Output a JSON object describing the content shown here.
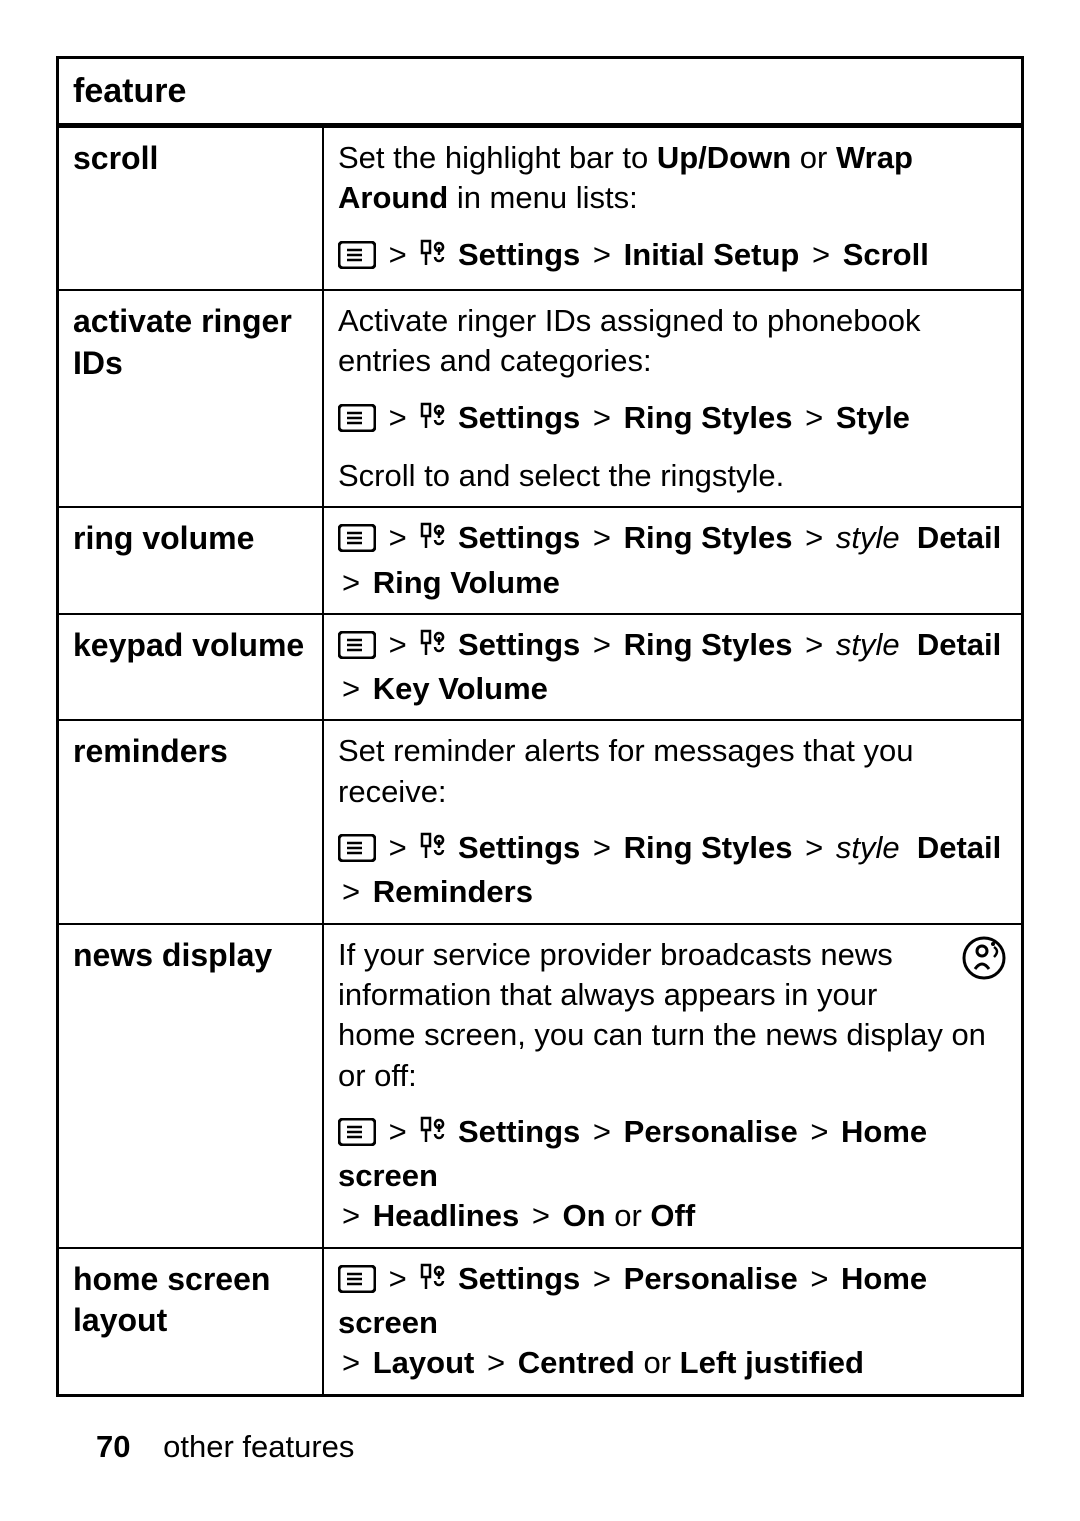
{
  "header": "feature",
  "rows": [
    {
      "feature": "scroll",
      "desc_pre": "Set the highlight bar to ",
      "desc_bold1": "Up/Down",
      "desc_mid": " or ",
      "desc_bold2": "Wrap Around",
      "desc_post": " in menu lists:",
      "nav": {
        "settings": "Settings",
        "p1": "Initial Setup",
        "p2": "Scroll"
      }
    },
    {
      "feature": "activate ringer IDs",
      "desc": "Activate ringer IDs assigned to phonebook entries and categories:",
      "nav": {
        "settings": "Settings",
        "p1": "Ring Styles",
        "p2": "Style"
      },
      "after": "Scroll to and select the ringstyle."
    },
    {
      "feature": "ring volume",
      "nav": {
        "settings": "Settings",
        "p1": "Ring Styles",
        "style_italic": "style",
        "detail": "Detail",
        "p3": "Ring Volume"
      }
    },
    {
      "feature": "keypad volume",
      "nav": {
        "settings": "Settings",
        "p1": "Ring Styles",
        "style_italic": "style",
        "detail": "Detail",
        "p3": "Key Volume"
      }
    },
    {
      "feature": "reminders",
      "desc": "Set reminder alerts for messages that you receive:",
      "nav": {
        "settings": "Settings",
        "p1": "Ring Styles",
        "style_italic": "style",
        "detail": "Detail",
        "p3": "Reminders"
      }
    },
    {
      "feature": "news display",
      "desc": "If your service provider broadcasts news information that always appears in your home screen, you can turn the news display on or off:",
      "operator_icon": true,
      "nav": {
        "settings": "Settings",
        "p1": "Personalise",
        "p2": "Home screen",
        "p3": "Headlines",
        "p4a": "On",
        "or": " or ",
        "p4b": "Off"
      }
    },
    {
      "feature": "home screen layout",
      "nav": {
        "settings": "Settings",
        "p1": "Personalise",
        "p2": "Home screen",
        "p3": "Layout",
        "p4a": "Centred",
        "or": " or ",
        "p4b": "Left justified"
      }
    }
  ],
  "footer": {
    "page": "70",
    "section": "other features"
  },
  "icons": {
    "menu": "menu-icon",
    "tool": "settings-tool-icon",
    "operator": "operator-icon"
  }
}
